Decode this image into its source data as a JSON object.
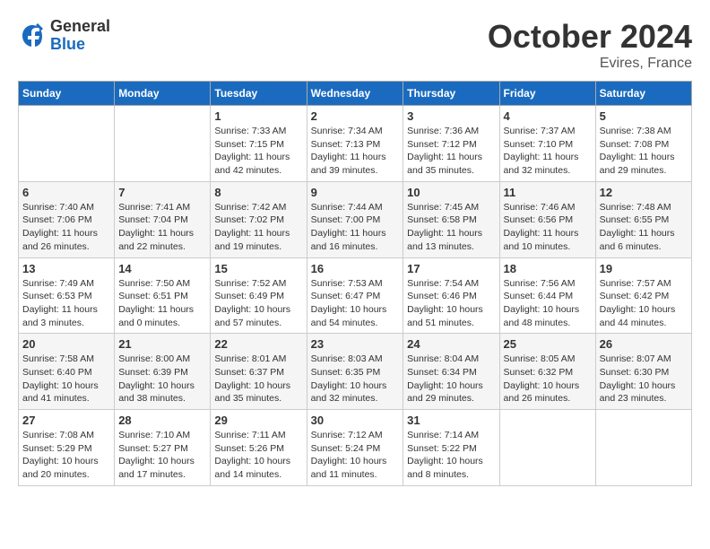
{
  "header": {
    "logo_general": "General",
    "logo_blue": "Blue",
    "title": "October 2024",
    "location": "Evires, France"
  },
  "weekdays": [
    "Sunday",
    "Monday",
    "Tuesday",
    "Wednesday",
    "Thursday",
    "Friday",
    "Saturday"
  ],
  "weeks": [
    [
      {
        "day": null
      },
      {
        "day": null
      },
      {
        "day": 1,
        "sunrise": "Sunrise: 7:33 AM",
        "sunset": "Sunset: 7:15 PM",
        "daylight": "Daylight: 11 hours and 42 minutes."
      },
      {
        "day": 2,
        "sunrise": "Sunrise: 7:34 AM",
        "sunset": "Sunset: 7:13 PM",
        "daylight": "Daylight: 11 hours and 39 minutes."
      },
      {
        "day": 3,
        "sunrise": "Sunrise: 7:36 AM",
        "sunset": "Sunset: 7:12 PM",
        "daylight": "Daylight: 11 hours and 35 minutes."
      },
      {
        "day": 4,
        "sunrise": "Sunrise: 7:37 AM",
        "sunset": "Sunset: 7:10 PM",
        "daylight": "Daylight: 11 hours and 32 minutes."
      },
      {
        "day": 5,
        "sunrise": "Sunrise: 7:38 AM",
        "sunset": "Sunset: 7:08 PM",
        "daylight": "Daylight: 11 hours and 29 minutes."
      }
    ],
    [
      {
        "day": 6,
        "sunrise": "Sunrise: 7:40 AM",
        "sunset": "Sunset: 7:06 PM",
        "daylight": "Daylight: 11 hours and 26 minutes."
      },
      {
        "day": 7,
        "sunrise": "Sunrise: 7:41 AM",
        "sunset": "Sunset: 7:04 PM",
        "daylight": "Daylight: 11 hours and 22 minutes."
      },
      {
        "day": 8,
        "sunrise": "Sunrise: 7:42 AM",
        "sunset": "Sunset: 7:02 PM",
        "daylight": "Daylight: 11 hours and 19 minutes."
      },
      {
        "day": 9,
        "sunrise": "Sunrise: 7:44 AM",
        "sunset": "Sunset: 7:00 PM",
        "daylight": "Daylight: 11 hours and 16 minutes."
      },
      {
        "day": 10,
        "sunrise": "Sunrise: 7:45 AM",
        "sunset": "Sunset: 6:58 PM",
        "daylight": "Daylight: 11 hours and 13 minutes."
      },
      {
        "day": 11,
        "sunrise": "Sunrise: 7:46 AM",
        "sunset": "Sunset: 6:56 PM",
        "daylight": "Daylight: 11 hours and 10 minutes."
      },
      {
        "day": 12,
        "sunrise": "Sunrise: 7:48 AM",
        "sunset": "Sunset: 6:55 PM",
        "daylight": "Daylight: 11 hours and 6 minutes."
      }
    ],
    [
      {
        "day": 13,
        "sunrise": "Sunrise: 7:49 AM",
        "sunset": "Sunset: 6:53 PM",
        "daylight": "Daylight: 11 hours and 3 minutes."
      },
      {
        "day": 14,
        "sunrise": "Sunrise: 7:50 AM",
        "sunset": "Sunset: 6:51 PM",
        "daylight": "Daylight: 11 hours and 0 minutes."
      },
      {
        "day": 15,
        "sunrise": "Sunrise: 7:52 AM",
        "sunset": "Sunset: 6:49 PM",
        "daylight": "Daylight: 10 hours and 57 minutes."
      },
      {
        "day": 16,
        "sunrise": "Sunrise: 7:53 AM",
        "sunset": "Sunset: 6:47 PM",
        "daylight": "Daylight: 10 hours and 54 minutes."
      },
      {
        "day": 17,
        "sunrise": "Sunrise: 7:54 AM",
        "sunset": "Sunset: 6:46 PM",
        "daylight": "Daylight: 10 hours and 51 minutes."
      },
      {
        "day": 18,
        "sunrise": "Sunrise: 7:56 AM",
        "sunset": "Sunset: 6:44 PM",
        "daylight": "Daylight: 10 hours and 48 minutes."
      },
      {
        "day": 19,
        "sunrise": "Sunrise: 7:57 AM",
        "sunset": "Sunset: 6:42 PM",
        "daylight": "Daylight: 10 hours and 44 minutes."
      }
    ],
    [
      {
        "day": 20,
        "sunrise": "Sunrise: 7:58 AM",
        "sunset": "Sunset: 6:40 PM",
        "daylight": "Daylight: 10 hours and 41 minutes."
      },
      {
        "day": 21,
        "sunrise": "Sunrise: 8:00 AM",
        "sunset": "Sunset: 6:39 PM",
        "daylight": "Daylight: 10 hours and 38 minutes."
      },
      {
        "day": 22,
        "sunrise": "Sunrise: 8:01 AM",
        "sunset": "Sunset: 6:37 PM",
        "daylight": "Daylight: 10 hours and 35 minutes."
      },
      {
        "day": 23,
        "sunrise": "Sunrise: 8:03 AM",
        "sunset": "Sunset: 6:35 PM",
        "daylight": "Daylight: 10 hours and 32 minutes."
      },
      {
        "day": 24,
        "sunrise": "Sunrise: 8:04 AM",
        "sunset": "Sunset: 6:34 PM",
        "daylight": "Daylight: 10 hours and 29 minutes."
      },
      {
        "day": 25,
        "sunrise": "Sunrise: 8:05 AM",
        "sunset": "Sunset: 6:32 PM",
        "daylight": "Daylight: 10 hours and 26 minutes."
      },
      {
        "day": 26,
        "sunrise": "Sunrise: 8:07 AM",
        "sunset": "Sunset: 6:30 PM",
        "daylight": "Daylight: 10 hours and 23 minutes."
      }
    ],
    [
      {
        "day": 27,
        "sunrise": "Sunrise: 7:08 AM",
        "sunset": "Sunset: 5:29 PM",
        "daylight": "Daylight: 10 hours and 20 minutes."
      },
      {
        "day": 28,
        "sunrise": "Sunrise: 7:10 AM",
        "sunset": "Sunset: 5:27 PM",
        "daylight": "Daylight: 10 hours and 17 minutes."
      },
      {
        "day": 29,
        "sunrise": "Sunrise: 7:11 AM",
        "sunset": "Sunset: 5:26 PM",
        "daylight": "Daylight: 10 hours and 14 minutes."
      },
      {
        "day": 30,
        "sunrise": "Sunrise: 7:12 AM",
        "sunset": "Sunset: 5:24 PM",
        "daylight": "Daylight: 10 hours and 11 minutes."
      },
      {
        "day": 31,
        "sunrise": "Sunrise: 7:14 AM",
        "sunset": "Sunset: 5:22 PM",
        "daylight": "Daylight: 10 hours and 8 minutes."
      },
      {
        "day": null
      },
      {
        "day": null
      }
    ]
  ]
}
